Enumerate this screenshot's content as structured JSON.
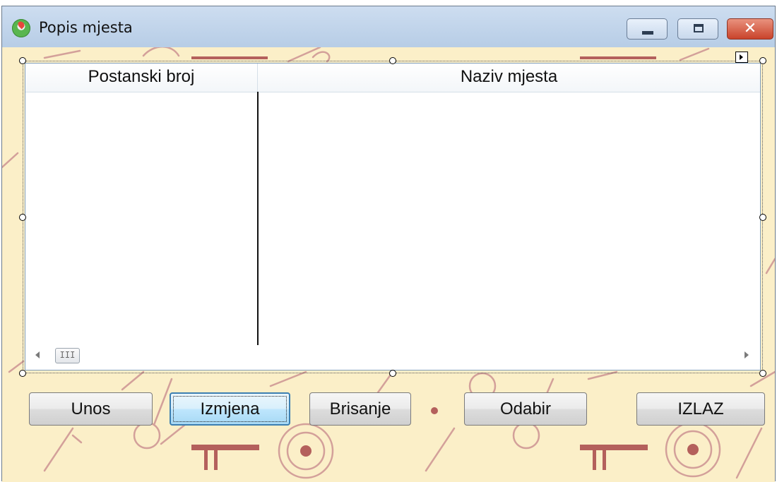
{
  "window": {
    "title": "Popis mjesta",
    "controls": {
      "minimize": "minimize-icon",
      "maximize": "maximize-icon",
      "close": "close-icon"
    }
  },
  "list": {
    "columns": [
      {
        "label": "Postanski broj"
      },
      {
        "label": "Naziv mjesta"
      }
    ],
    "rows": [],
    "scrollbar_thumb_glyph": "III"
  },
  "buttons": {
    "unos": "Unos",
    "izmjena": "Izmjena",
    "brisanje": "Brisanje",
    "odabir": "Odabir",
    "izlaz": "IZLAZ"
  },
  "colors": {
    "form_background": "#fbefc8",
    "pattern_ink": "#c98f86",
    "focus_accent": "#3c7fb1",
    "close_button": "#c9432b"
  }
}
